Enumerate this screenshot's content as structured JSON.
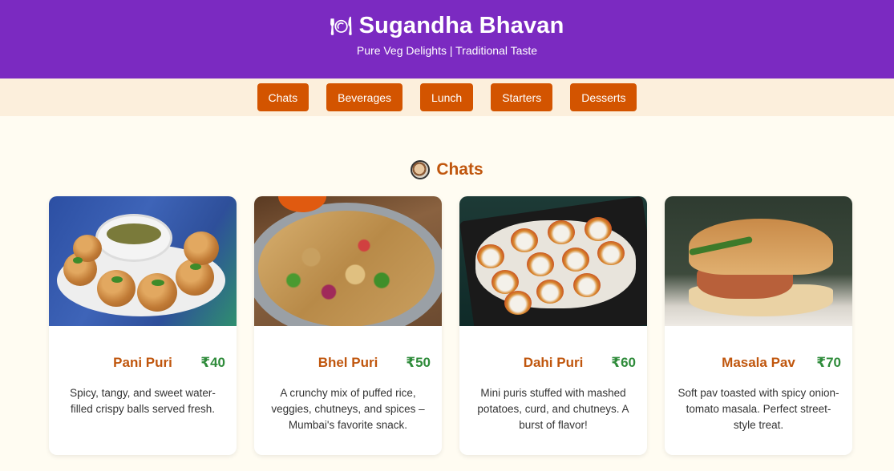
{
  "header": {
    "title": "Sugandha Bhavan",
    "tagline": "Pure Veg Delights | Traditional Taste",
    "icon": "plate-icon"
  },
  "nav": {
    "items": [
      "Chats",
      "Beverages",
      "Lunch",
      "Starters",
      "Desserts"
    ]
  },
  "section": {
    "title": "Chats",
    "icon": "bowl-icon"
  },
  "cards": [
    {
      "name": "Pani Puri",
      "price": "₹40",
      "description": "Spicy, tangy, and sweet water-filled crispy balls served fresh."
    },
    {
      "name": "Bhel Puri",
      "price": "₹50",
      "description": "A crunchy mix of puffed rice, veggies, chutneys, and spices – Mumbai's favorite snack."
    },
    {
      "name": "Dahi Puri",
      "price": "₹60",
      "description": "Mini puris stuffed with mashed potatoes, curd, and chutneys. A burst of flavor!"
    },
    {
      "name": "Masala Pav",
      "price": "₹70",
      "description": "Soft pav toasted with spicy onion-tomato masala. Perfect street-style treat."
    }
  ],
  "colors": {
    "header_bg": "#7b2ac1",
    "nav_bg": "#fcefdc",
    "button_bg": "#d35400",
    "title_color": "#c0560d",
    "price_color": "#2e8b3a",
    "page_bg": "#fffcf2"
  }
}
